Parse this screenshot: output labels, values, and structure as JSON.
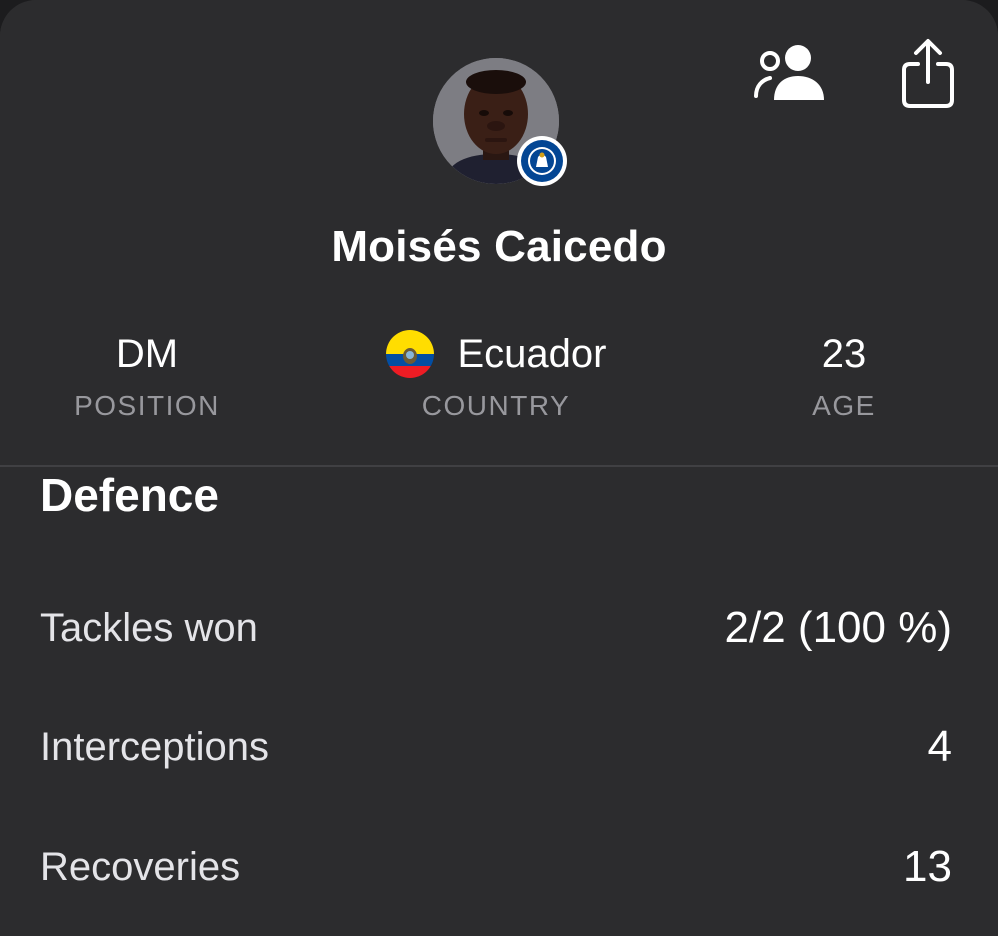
{
  "player": {
    "name": "Moisés Caicedo",
    "position": {
      "value": "DM",
      "label": "POSITION"
    },
    "country": {
      "value": "Ecuador",
      "label": "COUNTRY"
    },
    "age": {
      "value": "23",
      "label": "AGE"
    }
  },
  "actions": {
    "compare_icon": "compare-players-icon",
    "share_icon": "share-icon"
  },
  "section": {
    "title": "Defence",
    "stats": [
      {
        "label": "Tackles won",
        "value": "2/2 (100 %)"
      },
      {
        "label": "Interceptions",
        "value": "4"
      },
      {
        "label": "Recoveries",
        "value": "13"
      }
    ]
  },
  "colors": {
    "background": "#2c2c2e",
    "secondary_text": "#98989d",
    "divider": "#404043",
    "club_blue": "#034694"
  }
}
